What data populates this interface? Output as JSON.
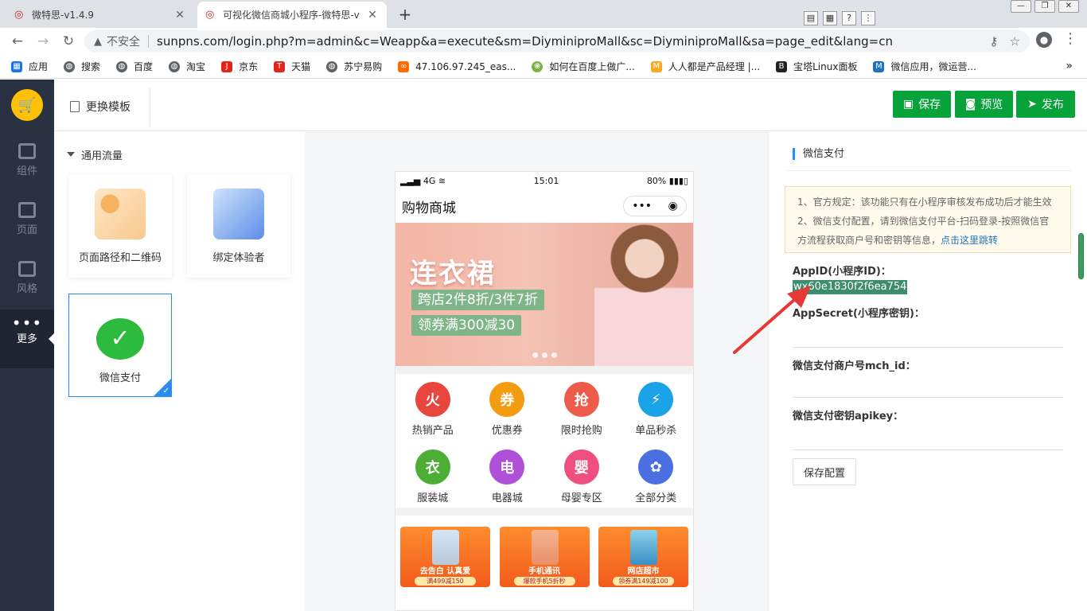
{
  "browser": {
    "tabs": [
      {
        "title": "微特思-v1.4.9",
        "active": false
      },
      {
        "title": "可视化微信商城小程序-微特思-v",
        "active": true
      }
    ],
    "address": {
      "security_label": "不安全",
      "url": "sunpns.com/login.php?m=admin&c=Weapp&a=execute&sm=DiyminiproMall&sc=DiyminiproMall&sa=page_edit&lang=cn"
    },
    "bookmarks": [
      {
        "label": "应用",
        "icon": "apps-grid-icon",
        "color": "#1a73e8"
      },
      {
        "label": "搜索",
        "icon": "globe-icon",
        "color": "#5f6368"
      },
      {
        "label": "百度",
        "icon": "globe-icon",
        "color": "#5f6368"
      },
      {
        "label": "淘宝",
        "icon": "globe-icon",
        "color": "#5f6368"
      },
      {
        "label": "京东",
        "icon": "jd-icon",
        "color": "#e1251b"
      },
      {
        "label": "天猫",
        "icon": "tmall-icon",
        "color": "#e1251b"
      },
      {
        "label": "苏宁易购",
        "icon": "globe-icon",
        "color": "#5f6368"
      },
      {
        "label": "47.106.97.245_eas...",
        "icon": "link-icon",
        "color": "#ff6a00"
      },
      {
        "label": "如何在百度上做广...",
        "icon": "globe-icon",
        "color": "#5f6368"
      },
      {
        "label": "如何在百度上做广...",
        "icon": "leaf-icon",
        "color": "#7cb342"
      },
      {
        "label": "人人都是产品经理 |...",
        "icon": "pm-icon",
        "color": "#f9a825"
      },
      {
        "label": "宝塔Linux面板",
        "icon": "bt-icon",
        "color": "#222222"
      },
      {
        "label": "微信应用，微运营...",
        "icon": "m-icon",
        "color": "#1e73be"
      }
    ]
  },
  "sidebar": {
    "items": [
      {
        "label": "组件",
        "active": false
      },
      {
        "label": "页面",
        "active": false
      },
      {
        "label": "风格",
        "active": false
      },
      {
        "label": "更多",
        "active": true
      }
    ]
  },
  "header": {
    "swap_template_label": "更换模板",
    "save_label": "保存",
    "preview_label": "预览",
    "publish_label": "发布"
  },
  "left_panel": {
    "section_title": "通用流量",
    "cards": [
      {
        "label": "页面路径和二维码",
        "selected": false
      },
      {
        "label": "绑定体验者",
        "selected": false
      },
      {
        "label": "微信支付",
        "selected": true
      }
    ]
  },
  "phone": {
    "carrier": "4G",
    "time": "15:01",
    "battery": "80%",
    "nav_title": "购物商城",
    "banner": {
      "headline": "连衣裙",
      "line1": "跨店2件8折/3件7折",
      "line2": "领券满300减30"
    },
    "grid": [
      {
        "label": "热销产品",
        "glyph": "火",
        "color": "#e8453c"
      },
      {
        "label": "优惠券",
        "glyph": "券",
        "color": "#f39c12"
      },
      {
        "label": "限时抢购",
        "glyph": "抢",
        "color": "#ef5b4b"
      },
      {
        "label": "单品秒杀",
        "glyph": "⚡",
        "color": "#1aa3e8"
      },
      {
        "label": "服装城",
        "glyph": "衣",
        "color": "#4cae34"
      },
      {
        "label": "电器城",
        "glyph": "电",
        "color": "#b04fd8"
      },
      {
        "label": "母婴专区",
        "glyph": "婴",
        "color": "#ef4f7e"
      },
      {
        "label": "全部分类",
        "glyph": "✿",
        "color": "#4b6fe0"
      }
    ],
    "promos": [
      {
        "title": "去告白 认真爱",
        "sub": "满499减150"
      },
      {
        "title": "手机通讯",
        "sub": "爆款手机5折秒"
      },
      {
        "title": "网店超市",
        "sub": "领券满149减100"
      }
    ]
  },
  "right_panel": {
    "title": "微信支付",
    "notice": {
      "line1": "1、官方规定：该功能只有在小程序审核发布成功后才能生效",
      "line2a": "2、微信支付配置，请到微信支付平台-扫码登录-按照微信官",
      "line2b": "方流程获取商户号和密钥等信息，",
      "link": "点击这里跳转"
    },
    "fields": [
      {
        "label": "AppID(小程序ID)：",
        "value": "wx60e1830f2f6ea754"
      },
      {
        "label": "AppSecret(小程序密钥)：",
        "value": ""
      },
      {
        "label": "微信支付商户号mch_id：",
        "value": ""
      },
      {
        "label": "微信支付密钥apikey：",
        "value": ""
      }
    ],
    "save_config_label": "保存配置"
  },
  "colors": {
    "primary_green": "#07a33a",
    "sidebar_bg": "#2a3140",
    "accent_blue": "#2d8cf0",
    "annotation_red": "#e53935"
  }
}
